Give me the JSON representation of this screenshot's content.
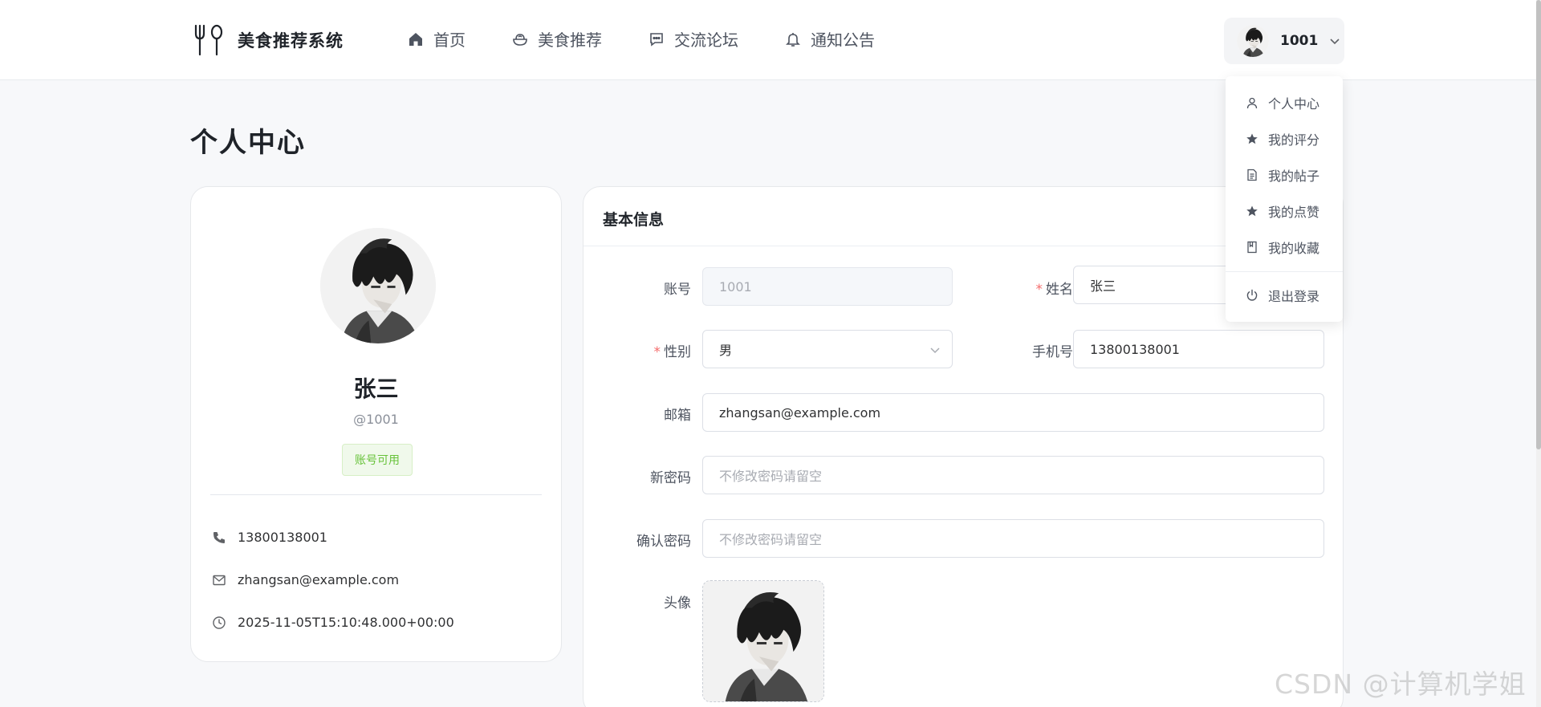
{
  "app": {
    "title": "美食推荐系统"
  },
  "nav": {
    "items": [
      {
        "label": "首页",
        "icon": "home-icon"
      },
      {
        "label": "美食推荐",
        "icon": "food-bowl-icon"
      },
      {
        "label": "交流论坛",
        "icon": "chat-icon"
      },
      {
        "label": "通知公告",
        "icon": "bell-icon"
      }
    ]
  },
  "user": {
    "account": "1001"
  },
  "dropdown": {
    "items": [
      {
        "label": "个人中心",
        "icon": "user-icon"
      },
      {
        "label": "我的评分",
        "icon": "star-icon"
      },
      {
        "label": "我的帖子",
        "icon": "document-icon"
      },
      {
        "label": "我的点赞",
        "icon": "star-icon"
      },
      {
        "label": "我的收藏",
        "icon": "bookmark-icon"
      }
    ],
    "logout": {
      "label": "退出登录",
      "icon": "power-icon"
    }
  },
  "page": {
    "title": "个人中心"
  },
  "profile": {
    "name": "张三",
    "handle": "@1001",
    "status": "账号可用",
    "phone": "13800138001",
    "email": "zhangsan@example.com",
    "created": "2025-11-05T15:10:48.000+00:00"
  },
  "form": {
    "header": "基本信息",
    "account": {
      "label": "账号",
      "value": "1001"
    },
    "name": {
      "label": "姓名",
      "value": "张三"
    },
    "gender": {
      "label": "性别",
      "value": "男"
    },
    "phone": {
      "label": "手机号",
      "value": "13800138001"
    },
    "email": {
      "label": "邮箱",
      "value": "zhangsan@example.com"
    },
    "new_password": {
      "label": "新密码",
      "placeholder": "不修改密码请留空"
    },
    "confirm_password": {
      "label": "确认密码",
      "placeholder": "不修改密码请留空"
    },
    "avatar": {
      "label": "头像"
    }
  },
  "watermark": "CSDN @计算机学姐",
  "colors": {
    "accent": "#409eff",
    "required": "#f56c6c",
    "success": "#67c23a"
  }
}
